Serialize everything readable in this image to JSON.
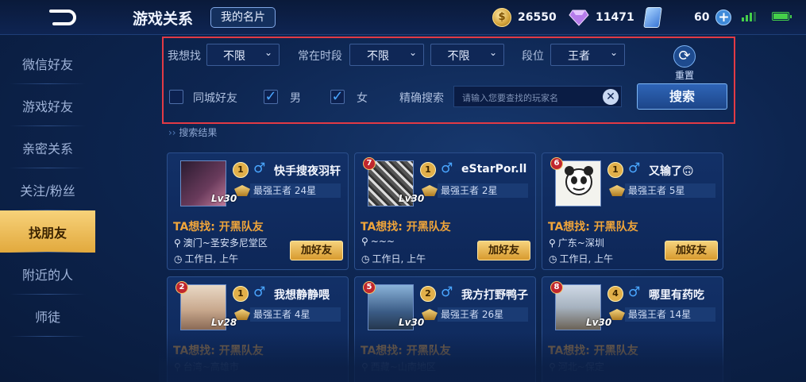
{
  "header": {
    "title": "游戏关系",
    "my_card_label": "我的名片",
    "gold": "26550",
    "diamond": "11471",
    "coupon": "60"
  },
  "sidebar": {
    "items": [
      {
        "label": "微信好友"
      },
      {
        "label": "游戏好友"
      },
      {
        "label": "亲密关系"
      },
      {
        "label": "关注/粉丝"
      },
      {
        "label": "找朋友",
        "active": true
      },
      {
        "label": "附近的人"
      },
      {
        "label": "师徒"
      }
    ]
  },
  "filters": {
    "looking_for_label": "我想找",
    "looking_for_value": "不限",
    "time_label": "常在时段",
    "time_value_1": "不限",
    "time_value_2": "不限",
    "rank_label": "段位",
    "rank_value": "王者",
    "reset_label": "重置",
    "same_city_label": "同城好友",
    "same_city_checked": false,
    "male_label": "男",
    "male_checked": true,
    "female_label": "女",
    "female_checked": true,
    "exact_search_label": "精确搜索",
    "search_placeholder": "请输入您要查找的玩家名",
    "search_button": "搜索"
  },
  "results": {
    "title": "搜索结果",
    "add_friend_label": "加好友",
    "cards": [
      {
        "rank_badge": "",
        "level": "Lv30",
        "vip": "1",
        "gender": "♂",
        "name": "快手搜夜羽轩",
        "rank": "最强王者 24星",
        "wants": "TA想找: 开黑队友",
        "location": "澳门~圣安多尼堂区",
        "time": "工作日, 上午"
      },
      {
        "rank_badge": "7",
        "level": "Lv30",
        "vip": "1",
        "gender": "♂",
        "name": "eStarPor.ll",
        "rank": "最强王者 2星",
        "wants": "TA想找: 开黑队友",
        "location": "~~~",
        "time": "工作日, 上午"
      },
      {
        "rank_badge": "6",
        "level": "",
        "vip": "1",
        "gender": "♂",
        "name": "又输了🙃",
        "rank": "最强王者 5星",
        "wants": "TA想找: 开黑队友",
        "location": "广东~深圳",
        "time": "工作日, 上午"
      },
      {
        "rank_badge": "2",
        "level": "Lv28",
        "vip": "1",
        "gender": "♂",
        "name": "我想静静喂",
        "rank": "最强王者 4星",
        "wants": "TA想找: 开黑队友",
        "location": "台湾~高雄市",
        "time": ""
      },
      {
        "rank_badge": "5",
        "level": "Lv30",
        "vip": "2",
        "gender": "♂",
        "name": "我方打野鸭子",
        "rank": "最强王者 26星",
        "wants": "TA想找: 开黑队友",
        "location": "西藏~山南地区",
        "time": ""
      },
      {
        "rank_badge": "8",
        "level": "Lv30",
        "vip": "4",
        "gender": "♂",
        "name": "哪里有药吃",
        "rank": "最强王者 14星",
        "wants": "TA想找: 开黑队友",
        "location": "河北~保定",
        "time": ""
      }
    ]
  }
}
